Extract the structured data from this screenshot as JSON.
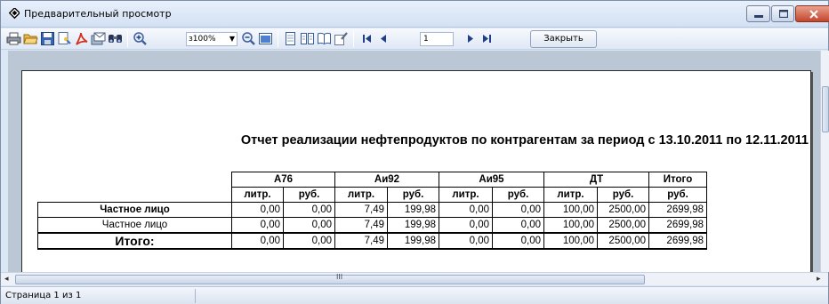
{
  "window": {
    "title": "Предварительный просмотр"
  },
  "toolbar": {
    "zoom_value": "100%",
    "zoom_prefix": "з",
    "page_value": "1",
    "close_label": "Закрыть"
  },
  "report": {
    "title": "Отчет реализации нефтепродуктов по контрагентам за период с 13.10.2011 по 12.11.2011",
    "groups": [
      "А76",
      "Аи92",
      "Аи95",
      "ДТ",
      "Итого"
    ],
    "subheaders": [
      "литр.",
      "руб.",
      "литр.",
      "руб.",
      "литр.",
      "руб.",
      "литр.",
      "руб.",
      "руб."
    ],
    "rows": [
      {
        "name": "Частное лицо",
        "values": [
          "0,00",
          "0,00",
          "7,49",
          "199,98",
          "0,00",
          "0,00",
          "100,00",
          "2500,00",
          "2699,98"
        ]
      },
      {
        "name": "Частное лицо",
        "values": [
          "0,00",
          "0,00",
          "7,49",
          "199,98",
          "0,00",
          "0,00",
          "100,00",
          "2500,00",
          "2699,98"
        ]
      }
    ],
    "total": {
      "name": "Итого:",
      "values": [
        "0,00",
        "0,00",
        "7,49",
        "199,98",
        "0,00",
        "0,00",
        "100,00",
        "2500,00",
        "2699,98"
      ]
    }
  },
  "scrollbar": {
    "grip": "III"
  },
  "status": {
    "text": "Страница 1 из 1"
  }
}
